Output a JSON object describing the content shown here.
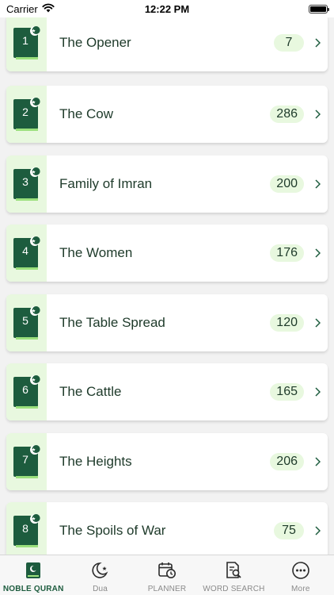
{
  "status_bar": {
    "carrier": "Carrier",
    "time": "12:22 PM"
  },
  "chapters": [
    {
      "number": "1",
      "title": "The Opener",
      "verses": "7"
    },
    {
      "number": "2",
      "title": "The Cow",
      "verses": "286"
    },
    {
      "number": "3",
      "title": "Family of Imran",
      "verses": "200"
    },
    {
      "number": "4",
      "title": "The Women",
      "verses": "176"
    },
    {
      "number": "5",
      "title": "The Table Spread",
      "verses": "120"
    },
    {
      "number": "6",
      "title": "The Cattle",
      "verses": "165"
    },
    {
      "number": "7",
      "title": "The Heights",
      "verses": "206"
    },
    {
      "number": "8",
      "title": "The Spoils of War",
      "verses": "75"
    }
  ],
  "tabs": [
    {
      "label": "NOBLE QURAN",
      "icon": "quran-book-icon",
      "active": true
    },
    {
      "label": "Dua",
      "icon": "moon-star-icon",
      "active": false
    },
    {
      "label": "PLANNER",
      "icon": "calendar-clock-icon",
      "active": false
    },
    {
      "label": "WORD SEARCH",
      "icon": "document-search-icon",
      "active": false
    },
    {
      "label": "More",
      "icon": "more-dots-icon",
      "active": false
    }
  ],
  "colors": {
    "primary": "#1d5c3e",
    "accent_light": "#e8f8df",
    "book_stripe": "#9be07d",
    "inactive": "#8a8a8a"
  }
}
